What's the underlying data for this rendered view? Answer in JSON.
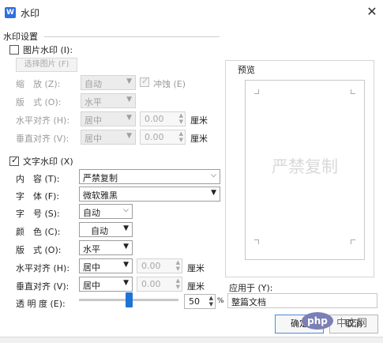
{
  "window": {
    "title": "水印",
    "app_icon": "W",
    "close_glyph": "✕"
  },
  "group_title": "水印设置",
  "picture": {
    "checkbox_label": "图片水印 (I):",
    "choose_button": "选择图片 (F)",
    "scale_label": "缩　放 (Z):",
    "scale_value": "自动",
    "washout_label": "冲蚀 (E)",
    "layout_label": "版　式 (O):",
    "layout_value": "水平",
    "halign_label": "水平对齐 (H):",
    "halign_value": "居中",
    "halign_offset": "0.00",
    "halign_unit": "厘米",
    "valign_label": "垂直对齐 (V):",
    "valign_value": "居中",
    "valign_offset": "0.00",
    "valign_unit": "厘米"
  },
  "text": {
    "checkbox_label": "文字水印 (X)",
    "content_label": "内　容 (T):",
    "content_value": "严禁复制",
    "font_label": "字　体 (F):",
    "font_value": "微软雅黑",
    "size_label": "字　号 (S):",
    "size_value": "自动",
    "color_label": "颜　色 (C):",
    "color_value": "自动",
    "layout_label": "版　式 (O):",
    "layout_value": "水平",
    "halign_label": "水平对齐 (H):",
    "halign_value": "居中",
    "halign_offset": "0.00",
    "halign_unit": "厘米",
    "valign_label": "垂直对齐 (V):",
    "valign_value": "居中",
    "valign_offset": "0.00",
    "valign_unit": "厘米",
    "transparency_label": "透 明 度 (E):",
    "transparency_value": "50",
    "transparency_unit": "%",
    "transparency_fraction": 0.5
  },
  "preview": {
    "label": "预览",
    "watermark_text": "严禁复制"
  },
  "apply": {
    "label": "应用于 (Y):",
    "value": "整篇文档"
  },
  "buttons": {
    "ok": "确定",
    "cancel": "取消"
  },
  "overlay_logo": {
    "brand": "php",
    "text": "中文网"
  },
  "colors": {
    "accent": "#1e73d6",
    "preview_text": "#d9d9d9"
  }
}
